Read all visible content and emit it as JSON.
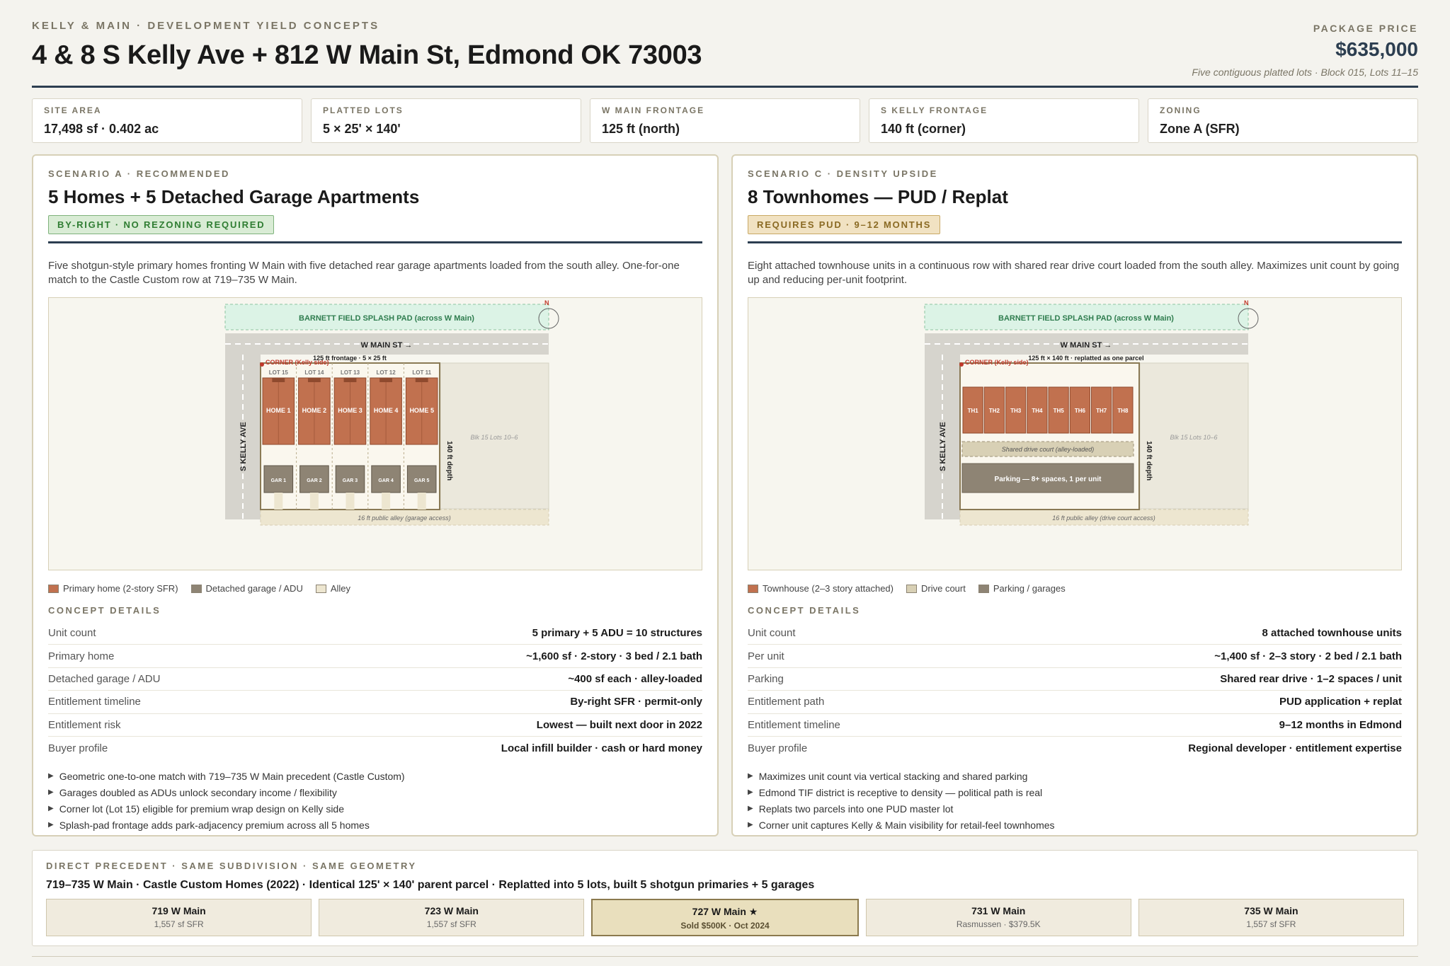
{
  "header": {
    "eyebrow": "KELLY & MAIN · DEVELOPMENT YIELD CONCEPTS",
    "title": "4 & 8 S Kelly Ave + 812 W Main St, Edmond OK 73003",
    "price_label": "PACKAGE PRICE",
    "price": "$635,000",
    "price_sub": "Five contiguous platted lots · Block 015, Lots 11–15"
  },
  "stats": [
    {
      "label": "SITE AREA",
      "value": "17,498 sf · 0.402 ac"
    },
    {
      "label": "PLATTED LOTS",
      "value": "5 × 25' × 140'"
    },
    {
      "label": "W MAIN FRONTAGE",
      "value": "125 ft (north)"
    },
    {
      "label": "S KELLY FRONTAGE",
      "value": "140 ft (corner)"
    },
    {
      "label": "ZONING",
      "value": "Zone A (SFR)"
    }
  ],
  "colors": {
    "navy": "#2c3e50",
    "home": "#c1714f",
    "garage": "#8e8474",
    "alley": "#ede6d0",
    "splash": "#dcf3e6",
    "court": "#d8d0b5"
  },
  "scenario_a": {
    "eyebrow": "SCENARIO A · RECOMMENDED",
    "title": "5 Homes + 5 Detached Garage Apartments",
    "badge": "BY-RIGHT · NO REZONING REQUIRED",
    "desc": "Five shotgun-style primary homes fronting W Main with five detached rear garage apartments loaded from the south alley. One-for-one match to the Castle Custom row at 719–735 W Main.",
    "map": {
      "splash": "BARNETT FIELD SPLASH PAD (across W Main)",
      "north": "N",
      "main_st": "W MAIN ST →",
      "kelly": "S KELLY AVE",
      "corner": "CORNER (Kelly side)",
      "frontage": "125 ft frontage · 5 × 25 ft",
      "depth": "140 ft depth",
      "block": "Blk 15 Lots 10–6",
      "alley": "16 ft public alley (garage access)",
      "lots": [
        "LOT 15",
        "LOT 14",
        "LOT 13",
        "LOT 12",
        "LOT 11"
      ],
      "homes": [
        "HOME 1",
        "HOME 2",
        "HOME 3",
        "HOME 4",
        "HOME 5"
      ],
      "garages": [
        "GAR 1",
        "GAR 2",
        "GAR 3",
        "GAR 4",
        "GAR 5"
      ]
    },
    "legend": [
      "Primary home (2-story SFR)",
      "Detached garage / ADU",
      "Alley"
    ],
    "details_head": "CONCEPT DETAILS",
    "details": [
      {
        "k": "Unit count",
        "v": "5 primary + 5 ADU = 10 structures"
      },
      {
        "k": "Primary home",
        "v": "~1,600 sf · 2-story · 3 bed / 2.1 bath"
      },
      {
        "k": "Detached garage / ADU",
        "v": "~400 sf each · alley-loaded"
      },
      {
        "k": "Entitlement timeline",
        "v": "By-right SFR · permit-only"
      },
      {
        "k": "Entitlement risk",
        "v": "Lowest — built next door in 2022"
      },
      {
        "k": "Buyer profile",
        "v": "Local infill builder · cash or hard money"
      }
    ],
    "bullets": [
      "Geometric one-to-one match with 719–735 W Main precedent (Castle Custom)",
      "Garages doubled as ADUs unlock secondary income / flexibility",
      "Corner lot (Lot 15) eligible for premium wrap design on Kelly side",
      "Splash-pad frontage adds park-adjacency premium across all 5 homes"
    ]
  },
  "scenario_c": {
    "eyebrow": "SCENARIO C · DENSITY UPSIDE",
    "title": "8 Townhomes — PUD / Replat",
    "badge": "REQUIRES PUD · 9–12 MONTHS",
    "desc": "Eight attached townhouse units in a continuous row with shared rear drive court loaded from the south alley. Maximizes unit count by going up and reducing per-unit footprint.",
    "map": {
      "splash": "BARNETT FIELD SPLASH PAD (across W Main)",
      "north": "N",
      "main_st": "W MAIN ST →",
      "kelly": "S KELLY AVE",
      "corner": "CORNER (Kelly side)",
      "frontage": "125 ft × 140 ft · replatted as one parcel",
      "depth": "140 ft depth",
      "block": "Blk 15 Lots 10–6",
      "alley": "16 ft public alley (drive court access)",
      "units": [
        "TH1",
        "TH2",
        "TH3",
        "TH4",
        "TH5",
        "TH6",
        "TH7",
        "TH8"
      ],
      "court": "Shared drive court (alley-loaded)",
      "parking": "Parking — 8+ spaces, 1 per unit"
    },
    "legend": [
      "Townhouse (2–3 story attached)",
      "Drive court",
      "Parking / garages"
    ],
    "details_head": "CONCEPT DETAILS",
    "details": [
      {
        "k": "Unit count",
        "v": "8 attached townhouse units"
      },
      {
        "k": "Per unit",
        "v": "~1,400 sf · 2–3 story · 2 bed / 2.1 bath"
      },
      {
        "k": "Parking",
        "v": "Shared rear drive · 1–2 spaces / unit"
      },
      {
        "k": "Entitlement path",
        "v": "PUD application + replat"
      },
      {
        "k": "Entitlement timeline",
        "v": "9–12 months in Edmond"
      },
      {
        "k": "Buyer profile",
        "v": "Regional developer · entitlement expertise"
      }
    ],
    "bullets": [
      "Maximizes unit count via vertical stacking and shared parking",
      "Edmond TIF district is receptive to density — political path is real",
      "Replats two parcels into one PUD master lot",
      "Corner unit captures Kelly & Main visibility for retail-feel townhomes"
    ]
  },
  "precedent": {
    "eyebrow": "DIRECT PRECEDENT · SAME SUBDIVISION · SAME GEOMETRY",
    "title": "719–735 W Main · Castle Custom Homes (2022) · Identical 125' × 140' parent parcel · Replatted into 5 lots, built 5 shotgun primaries + 5 garages",
    "tiles": [
      {
        "addr": "719 W Main",
        "sub": "1,557 sf SFR"
      },
      {
        "addr": "723 W Main",
        "sub": "1,557 sf SFR"
      },
      {
        "addr": "727 W Main ★",
        "sub": "Sold $500K · Oct 2024"
      },
      {
        "addr": "731 W Main",
        "sub": "Rasmussen · $379.5K"
      },
      {
        "addr": "735 W Main",
        "sub": "1,557 sf SFR"
      }
    ]
  }
}
